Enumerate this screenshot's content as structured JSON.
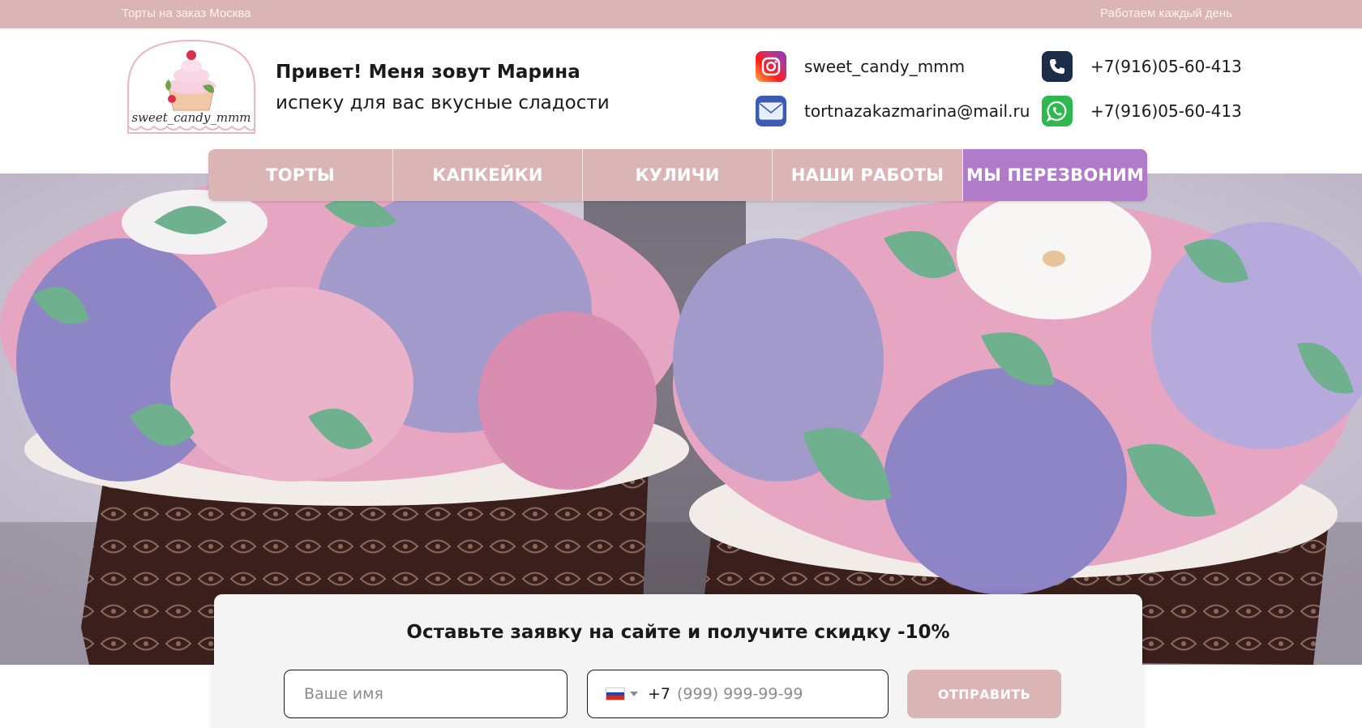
{
  "topbar": {
    "left_text": "Торты на заказ Москва",
    "right_text": "Работаем каждый день"
  },
  "header": {
    "logo_text": "sweet_candy_mmm",
    "greeting_title": "Привет! Меня зовут Марина",
    "greeting_subtitle": "испеку для вас вкусные сладости",
    "contacts": {
      "instagram": "sweet_candy_mmm",
      "email": "tortnazakazmarina@mail.ru",
      "phone": "+7(916)05-60-413",
      "whatsapp": "+7(916)05-60-413"
    }
  },
  "nav": {
    "items": [
      {
        "label": "ТОРТЫ"
      },
      {
        "label": "КАПКЕЙКИ"
      },
      {
        "label": "КУЛИЧИ"
      },
      {
        "label": "НАШИ РАБОТЫ"
      },
      {
        "label": "МЫ ПЕРЕЗВОНИМ"
      }
    ]
  },
  "form": {
    "title": "Оставьте заявку на сайте и получите скидку -10%",
    "name_placeholder": "Ваше имя",
    "country_code": "+7",
    "phone_placeholder": "(999) 999-99-99",
    "submit_label": "ОТПРАВИТЬ"
  },
  "colors": {
    "accent_pink": "#dbb4b6",
    "accent_purple": "#b27bc9"
  },
  "icons": [
    "instagram-icon",
    "mail-icon",
    "phone-icon",
    "whatsapp-icon",
    "russia-flag-icon",
    "chevron-down-icon"
  ]
}
